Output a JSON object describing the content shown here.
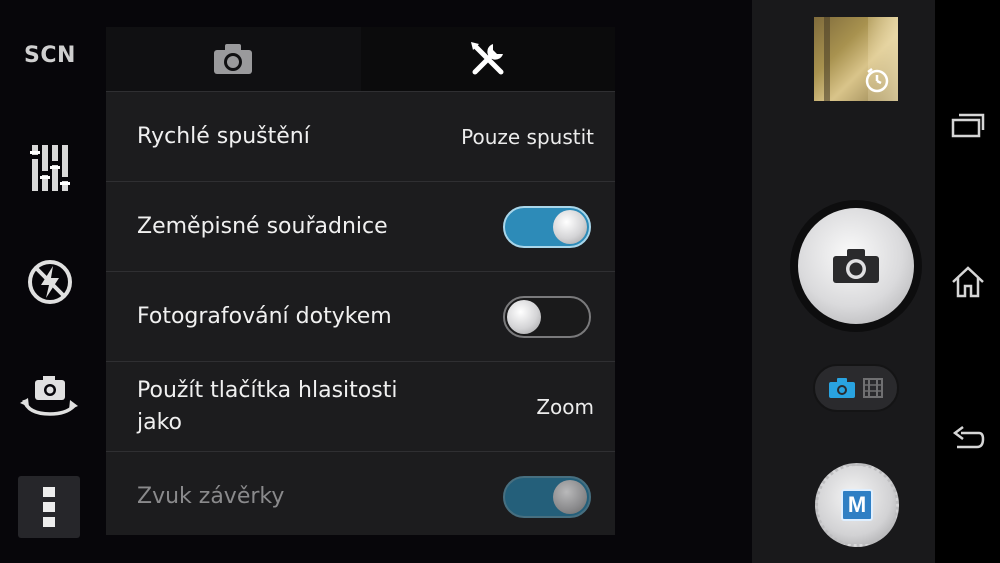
{
  "left_toolbar": {
    "scene_label": "SCN",
    "icons": [
      "settings-sliders-icon",
      "flash-off-icon",
      "switch-camera-icon",
      "more-options-icon"
    ]
  },
  "settings_panel": {
    "tabs": [
      {
        "icon": "camera-icon",
        "active": false
      },
      {
        "icon": "tools-icon",
        "active": true
      }
    ],
    "rows": [
      {
        "label": "Rychlé spuštění",
        "value": "Pouze spustit"
      },
      {
        "label": "Zeměpisné souřadnice",
        "toggle": "on"
      },
      {
        "label": "Fotografování dotykem",
        "toggle": "off"
      },
      {
        "label": "Použít tlačítka hlasitosti jako",
        "value": "Zoom"
      },
      {
        "label": "Zvuk závěrky",
        "toggle": "on",
        "disabled": true
      }
    ]
  },
  "camera_controls": {
    "thumbnail_icon": "self-timer-icon",
    "shutter_icon": "camera-icon",
    "mode_switch_icons": [
      "camera-icon",
      "video-icon"
    ],
    "manual_mode_label": "M"
  },
  "navbar": {
    "icons": [
      "recent-apps-icon",
      "home-icon",
      "back-icon"
    ]
  },
  "colors": {
    "accent": "#2d8bb8",
    "panel_bg": "#1c1c1e"
  }
}
